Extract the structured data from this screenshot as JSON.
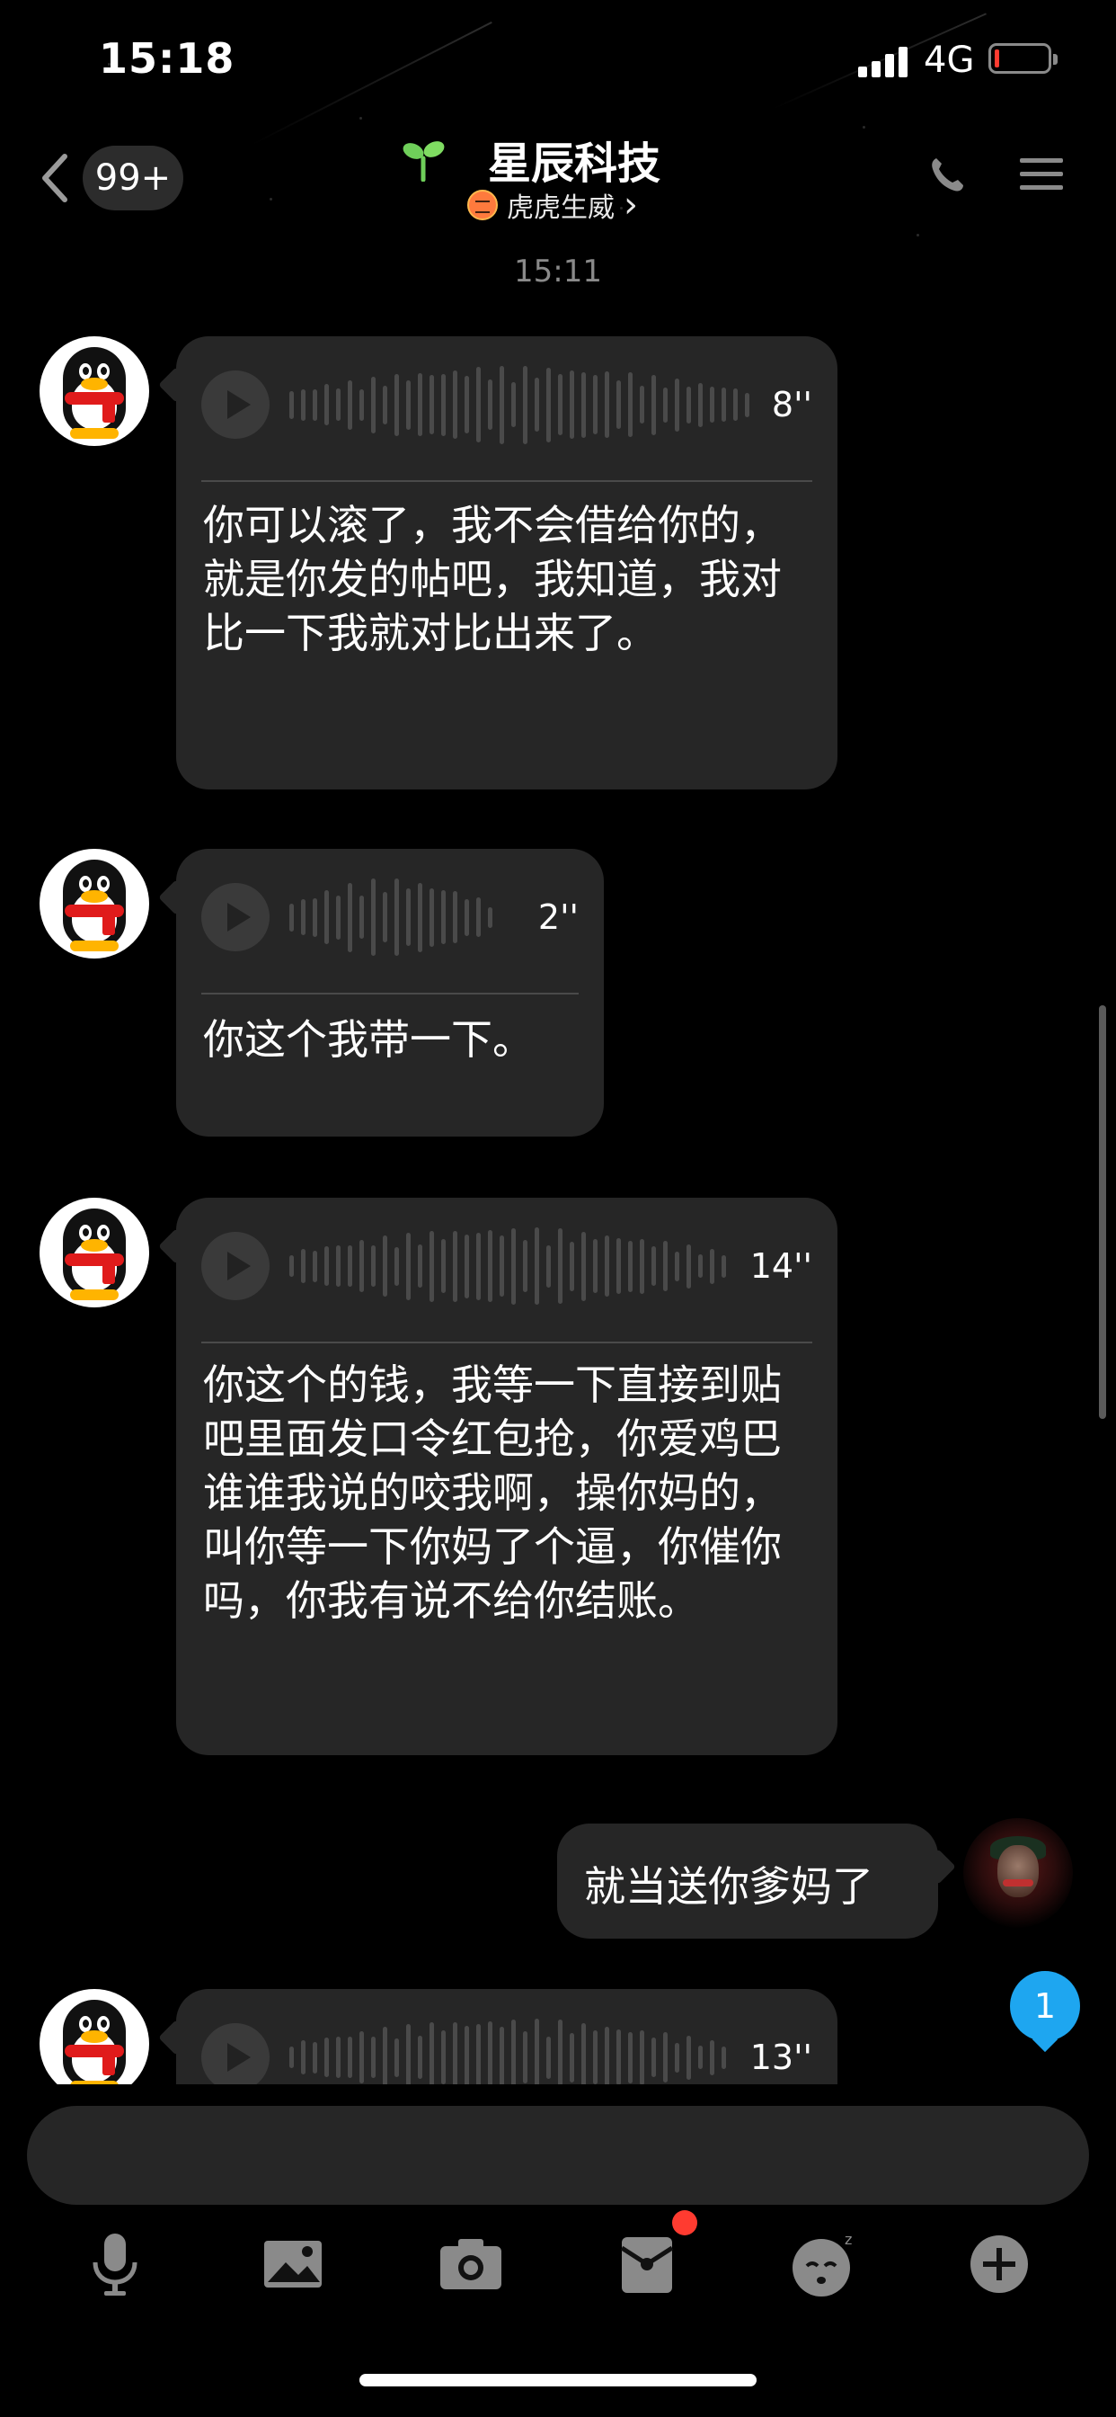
{
  "status_bar": {
    "time": "15:18",
    "network": "4G"
  },
  "nav": {
    "unread_count": "99+",
    "title": "星辰科技",
    "subtitle": "虎虎生威",
    "subtitle_chevron": "›"
  },
  "timestamp": "15:11",
  "messages": [
    {
      "type": "voice",
      "duration": "8''",
      "text": "你可以滚了，我不会借给你的，就是你发的帖吧，我知道，我对比一下我就对比出来了。"
    },
    {
      "type": "voice",
      "duration": "2''",
      "text": "你这个我带一下。"
    },
    {
      "type": "voice",
      "duration": "14''",
      "text": "你这个的钱，我等一下直接到贴吧里面发口令红包抢，你爱鸡巴谁谁我说的咬我啊，操你妈的，叫你等一下你妈了个逼，你催你吗，你我有说不给你结账。"
    },
    {
      "type": "text_outgoing",
      "text": "就当送你爹妈了"
    },
    {
      "type": "voice",
      "duration": "13''",
      "text": ""
    }
  ],
  "new_message_count": "1",
  "input": {
    "placeholder": ""
  },
  "toolbar": [
    "microphone-icon",
    "image-icon",
    "camera-icon",
    "red-packet-icon",
    "emoji-icon",
    "plus-icon"
  ]
}
